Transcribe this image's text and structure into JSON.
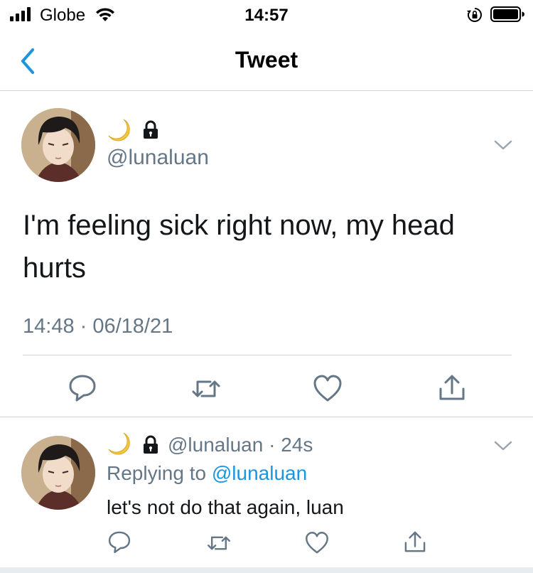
{
  "status_bar": {
    "carrier": "Globe",
    "time": "14:57"
  },
  "nav": {
    "title": "Tweet"
  },
  "main_tweet": {
    "display_name_emoji": "🌙",
    "handle": "@lunaluan",
    "text": "I'm feeling sick right now, my head hurts",
    "timestamp": "14:48 · 06/18/21"
  },
  "reply": {
    "handle": "@lunaluan",
    "age": "24s",
    "replying_prefix": "Replying to",
    "replying_to": "@lunaluan",
    "text": "let's not do that again, luan"
  },
  "colors": {
    "accent": "#1b95e0",
    "secondary_text": "#657786",
    "icon": "#657786"
  },
  "icons": [
    "signal-icon",
    "wifi-icon",
    "rotation-lock-icon",
    "battery-icon",
    "back-chevron-icon",
    "moon-icon",
    "lock-icon",
    "chevron-down-icon",
    "reply-icon",
    "retweet-icon",
    "like-icon",
    "share-icon"
  ]
}
